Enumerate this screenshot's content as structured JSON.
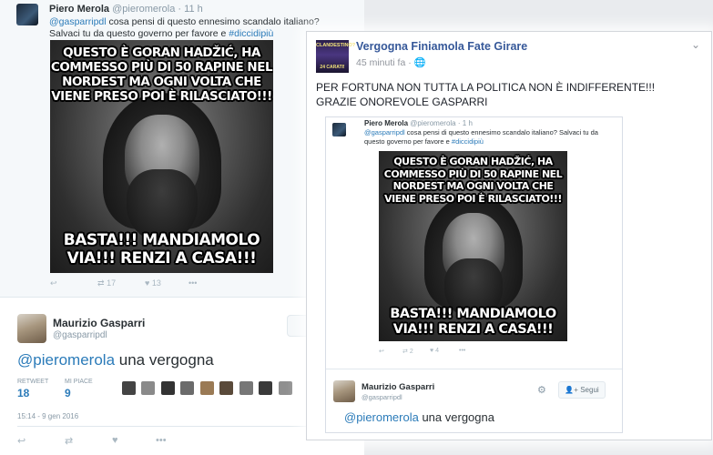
{
  "twitter": {
    "tweet1": {
      "name": "Piero Merola",
      "handle": "@pieromerola",
      "time": "11 h",
      "mention": "@gasparripdl",
      "text": " cosa pensi di questo ennesimo scandalo italiano? Salvaci tu da questo governo per favore e ",
      "hashtag": "#diccidipiù",
      "meme_top": "Questo è Goran Hadžić, ha commesso più di 50 rapine nel nordest ma ogni volta che viene preso poi è rilasciato!!!",
      "meme_bottom": "BASTA!!! MANDIAMOLO VIA!!! RENZI A CASA!!!",
      "retweets": "17",
      "likes": "13"
    },
    "tweet2": {
      "name": "Maurizio Gasparri",
      "handle": "@gasparripdl",
      "follow_label": "",
      "mention": "@pieromerola",
      "text": " una vergogna",
      "retweet_label": "RETWEET",
      "retweet_count": "18",
      "likes_label": "MI PIACE",
      "likes_count": "9",
      "date": "15:14 - 9 gen 2016"
    }
  },
  "facebook": {
    "page_name": "Vergogna Finiamola Fate Girare",
    "time": "45 minuti fa",
    "avatar_text_top": "CLANDESTINO?",
    "avatar_text_bottom": "24 CARATI!",
    "post_text_line1": "PER FORTUNA NON TUTTA LA POLITICA NON È INDIFFERENTE!!!",
    "post_text_line2": "GRAZIE ONOREVOLE GASPARRI",
    "embed": {
      "tweet1": {
        "name": "Piero Merola",
        "handle": "@pieromerola",
        "time": "1 h",
        "mention": "@gasparripdl",
        "text": " cosa pensi di questo ennesimo scandalo italiano? Salvaci tu da questo governo per favore e ",
        "hashtag": "#diccidipiù",
        "meme_top": "Questo è Goran Hadžić, ha commesso più di 50 rapine nel nordest ma ogni volta che viene preso poi è rilasciato!!!",
        "meme_bottom": "BASTA!!! MANDIAMOLO VIA!!! RENZI A CASA!!!",
        "retweets": "2",
        "likes": "4"
      },
      "tweet2": {
        "name": "Maurizio Gasparri",
        "handle": "@gasparripdl",
        "follow_label": "Segui",
        "mention": "@pieromerola",
        "text": " una vergogna"
      }
    }
  },
  "icons": {
    "reply": "reply-icon",
    "retweet": "retweet-icon",
    "like": "heart-icon",
    "more": "more-icon",
    "gear": "gear-icon",
    "follow": "follow-icon",
    "globe": "globe-icon",
    "chevron": "chevron-down-icon"
  },
  "colors": {
    "twitter_link": "#2b7bb9",
    "facebook_name": "#365899"
  }
}
